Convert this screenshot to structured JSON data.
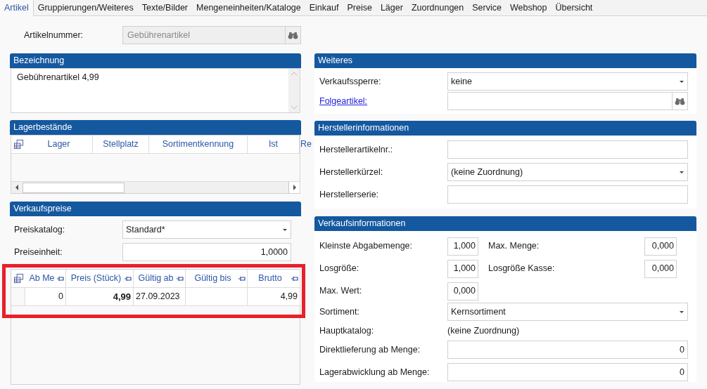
{
  "tabs": [
    {
      "label": "Artikel",
      "selected": true
    },
    {
      "label": "Gruppierungen/Weiteres",
      "selected": false
    },
    {
      "label": "Texte/Bilder",
      "selected": false
    },
    {
      "label": "Mengeneinheiten/Kataloge",
      "selected": false
    },
    {
      "label": "Einkauf",
      "selected": false
    },
    {
      "label": "Preise",
      "selected": false
    },
    {
      "label": "Läger",
      "selected": false
    },
    {
      "label": "Zuordnungen",
      "selected": false
    },
    {
      "label": "Service",
      "selected": false
    },
    {
      "label": "Webshop",
      "selected": false
    },
    {
      "label": "Übersicht",
      "selected": false
    }
  ],
  "article_number": {
    "label": "Artikelnummer:",
    "value": "Gebührenartikel",
    "disabled": true
  },
  "bezeichnung": {
    "title": "Bezeichnung",
    "value": "Gebührenartikel 4,99"
  },
  "lagerbestaende": {
    "title": "Lagerbestände",
    "columns": [
      "Lager",
      "Stellplatz",
      "Sortimentkennung",
      "Ist",
      "Re"
    ]
  },
  "verkaufspreise": {
    "title": "Verkaufspreise",
    "fields": [
      {
        "kind": "dropdown",
        "label": "Preiskatalog:",
        "value": "Standard*"
      },
      {
        "kind": "number",
        "label": "Preiseinheit:",
        "value": "1,0000"
      }
    ],
    "table": {
      "columns": [
        "Ab Me",
        "Preis (Stück)",
        "Gültig ab",
        "Gültig bis",
        "Brutto"
      ],
      "rows": [
        [
          {
            "text": "0",
            "bold": false
          },
          {
            "text": "4,99",
            "bold": true
          },
          {
            "text": "27.09.2023",
            "bold": false
          },
          {},
          {
            "text": "4,99",
            "bold": false
          }
        ]
      ]
    }
  },
  "weiteres": {
    "title": "Weiteres",
    "fields": [
      {
        "kind": "dropdown",
        "label": "Verkaufssperre:",
        "value": "keine",
        "link": false
      },
      {
        "kind": "lookup",
        "label": "Folgeartikel:",
        "link": true
      }
    ]
  },
  "herstellerinformationen": {
    "title": "Herstellerinformationen",
    "fields": [
      {
        "kind": "text",
        "label": "Herstellerartikelnr.:"
      },
      {
        "kind": "dropdown",
        "label": "Herstellerkürzel:",
        "value": "(keine Zuordnung)"
      },
      {
        "kind": "text",
        "label": "Herstellerserie:"
      }
    ]
  },
  "verkaufsinformationen": {
    "title": "Verkaufsinformationen",
    "pairs": [
      [
        {
          "label": "Kleinste Abgabemenge:",
          "value": "1,000"
        },
        {
          "label": "Max. Menge:",
          "value": "0,000"
        }
      ],
      [
        {
          "label": "Losgröße:",
          "value": "1,000"
        },
        {
          "label": "Losgröße Kasse:",
          "value": "0,000"
        }
      ],
      [
        {
          "label": "Max. Wert:",
          "value": "0,000"
        }
      ]
    ],
    "fields": [
      {
        "kind": "dropdown",
        "label": "Sortiment:",
        "value": "Kernsortiment"
      },
      {
        "kind": "static",
        "label": "Hauptkatalog:",
        "value": "(keine Zuordnung)"
      },
      {
        "kind": "number",
        "label": "Direktlieferung ab Menge:",
        "value": "0"
      },
      {
        "kind": "number",
        "label": "Lagerabwicklung ab Menge:",
        "value": "0"
      }
    ]
  }
}
